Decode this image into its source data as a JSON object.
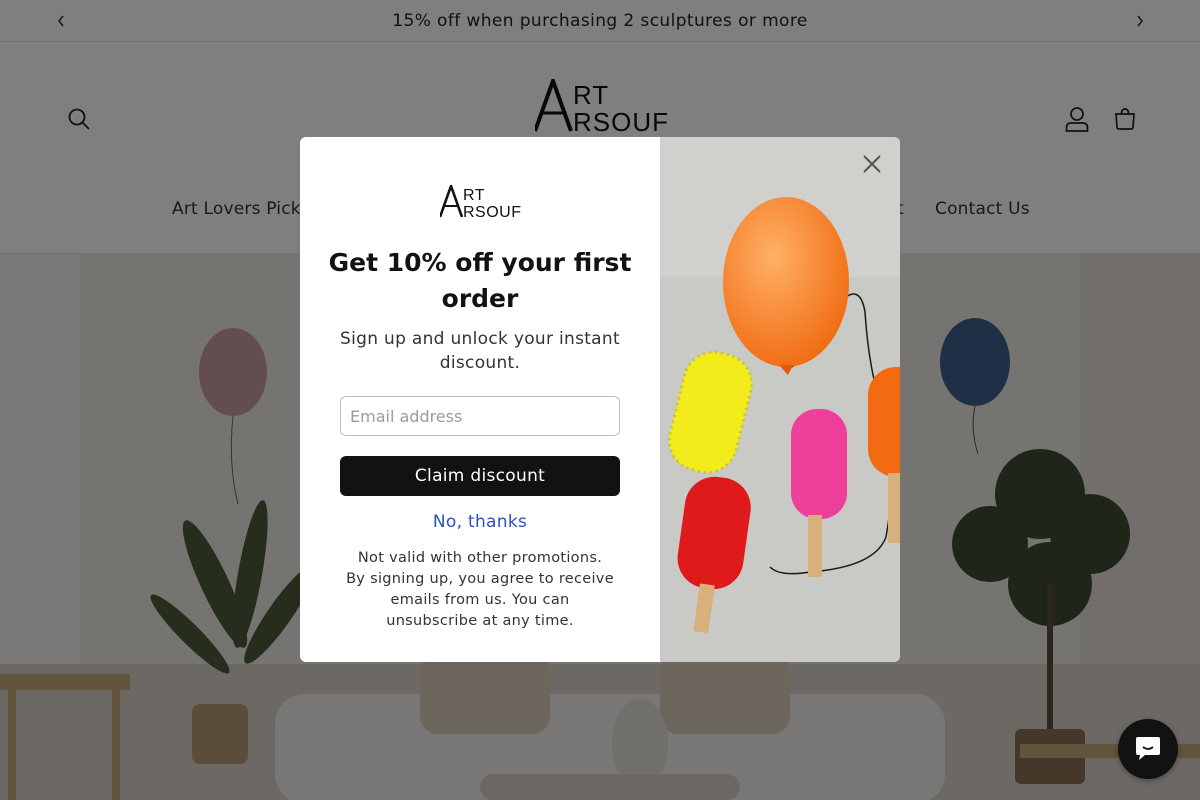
{
  "announcement": {
    "text": "15% off when purchasing 2 sculptures or more",
    "prev_icon": "chevron-left-icon",
    "next_icon": "chevron-right-icon"
  },
  "header": {
    "brand_logo": "ART ARSOUF",
    "icons": [
      "search-icon",
      "account-icon",
      "cart-icon"
    ]
  },
  "nav": {
    "items": [
      {
        "label": "Art Lovers Picks"
      },
      {
        "label": "t"
      },
      {
        "label": "Contact Us"
      }
    ]
  },
  "popup": {
    "logo": "ART ARSOUF",
    "title": "Get 10% off your first order",
    "subtitle_line1": "Sign up and unlock your instant",
    "subtitle_line2": "discount.",
    "email_placeholder": "Email address",
    "email_value": "",
    "claim_label": "Claim discount",
    "no_thanks_label": "No, thanks",
    "fine_print": [
      "Not valid with other promotions.",
      "By signing up, you agree to receive",
      "emails from us. You can",
      "unsubscribe at any time."
    ],
    "close_icon": "close-icon"
  },
  "chat": {
    "icon": "chat-icon"
  },
  "colors": {
    "accent_link": "#2a52be",
    "button_bg": "#121212",
    "overlay": "rgba(0,0,0,0.5)"
  }
}
